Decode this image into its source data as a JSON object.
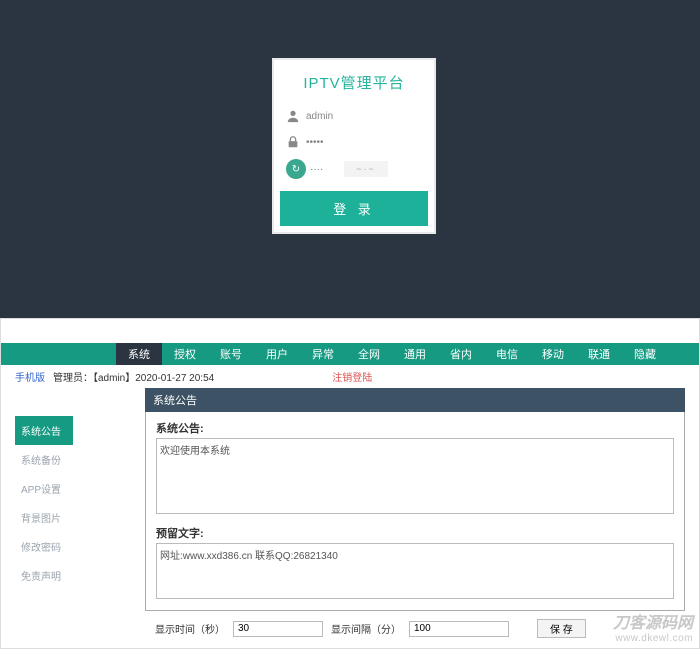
{
  "login": {
    "title": "IPTV管理平台",
    "username": "admin",
    "password": "·····",
    "captcha_placeholder": "····",
    "button": "登 录"
  },
  "nav": {
    "items": [
      "系统",
      "授权",
      "账号",
      "用户",
      "异常",
      "全网",
      "通用",
      "省内",
      "电信",
      "移动",
      "联通",
      "隐藏"
    ],
    "active_index": 0
  },
  "infobar": {
    "phone": "手机版",
    "admin_label": "管理员：【admin】2020-01-27 20:54",
    "logout": "注销登陆"
  },
  "sidebar": {
    "items": [
      "系统公告",
      "系统备份",
      "APP设置",
      "背景图片",
      "修改密码",
      "免责声明"
    ],
    "active_index": 0
  },
  "panel": {
    "header": "系统公告",
    "field1_label": "系统公告:",
    "field1_value": "欢迎使用本系统",
    "field2_label": "预留文字:",
    "field2_value": "网址:www.xxd386.cn 联系QQ:26821340"
  },
  "controls": {
    "label1": "显示时间（秒）",
    "value1": "30",
    "label2": "显示间隔（分）",
    "value2": "100",
    "save": "保 存"
  },
  "watermark": {
    "line1": "刀客源码网",
    "line2": "www.dkewl.com"
  }
}
